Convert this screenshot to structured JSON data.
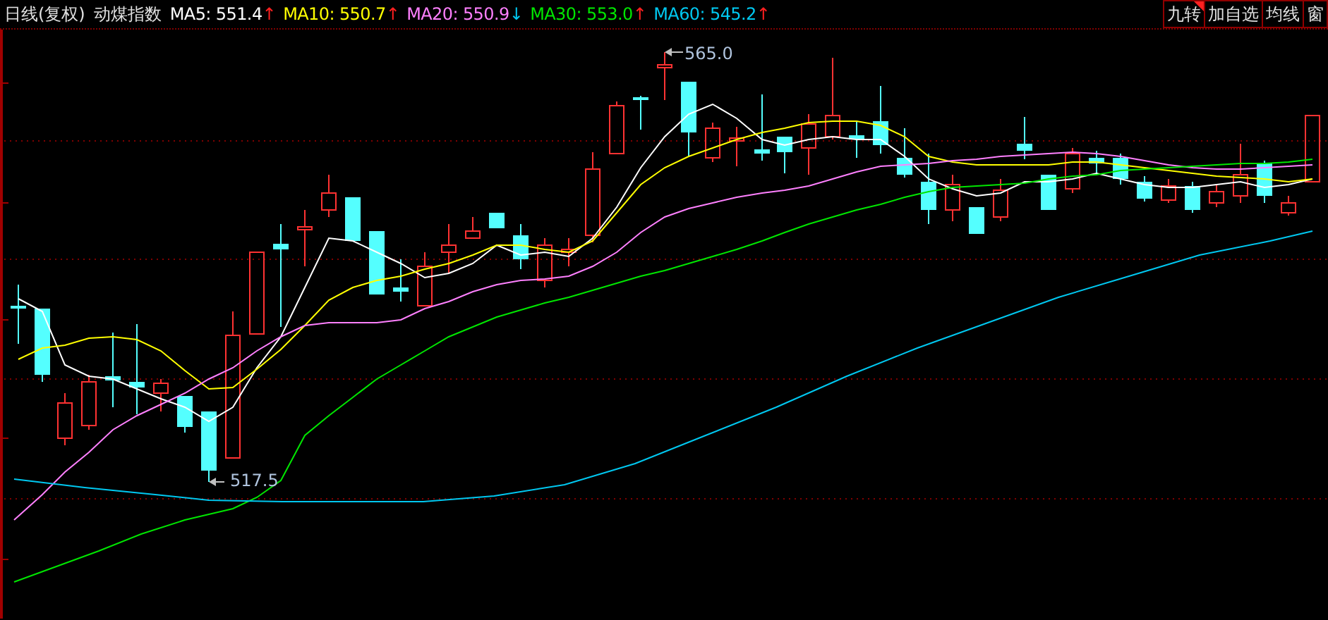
{
  "header": {
    "period": "日线(复权)",
    "index_name": "动煤指数",
    "moving_averages": [
      {
        "label": "MA5:",
        "value": "551.4",
        "color": "#ffffff",
        "trend": {
          "arrow": "↑",
          "color": "#ff2020"
        }
      },
      {
        "label": "MA10:",
        "value": "550.7",
        "color": "#ffff00",
        "trend": {
          "arrow": "↑",
          "color": "#ff2020"
        }
      },
      {
        "label": "MA20:",
        "value": "550.9",
        "color": "#ff80ff",
        "trend": {
          "arrow": "↓",
          "color": "#00c8f0"
        }
      },
      {
        "label": "MA30:",
        "value": "553.0",
        "color": "#00e600",
        "trend": {
          "arrow": "↑",
          "color": "#ff2020"
        }
      },
      {
        "label": "MA60:",
        "value": "545.2",
        "color": "#00c8f0",
        "trend": {
          "arrow": "↑",
          "color": "#ff2020"
        }
      }
    ],
    "buttons": [
      {
        "label": "九转",
        "flagged": true
      },
      {
        "label": "加自选",
        "flagged": false
      },
      {
        "label": "均线",
        "flagged": false
      },
      {
        "label": "窗",
        "flagged": false
      }
    ]
  },
  "chart": {
    "high_label": "565.0",
    "low_label": "517.5"
  }
}
